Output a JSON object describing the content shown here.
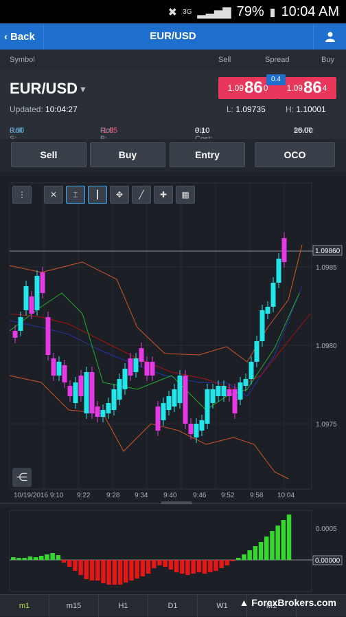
{
  "status": {
    "signal": "3G",
    "battery": "79%",
    "time": "10:04 AM"
  },
  "nav": {
    "back": "Back",
    "title": "EUR/USD"
  },
  "columns": {
    "symbol": "Symbol",
    "sell": "Sell",
    "spread": "Spread",
    "buy": "Buy"
  },
  "quote": {
    "symbol": "EUR/USD",
    "updated_label": "Updated:",
    "updated_time": "10:04:27",
    "sell_small": "1.09",
    "sell_big": "86",
    "sell_pip": "0",
    "buy_small": "1.09",
    "buy_big": "86",
    "buy_pip": "4",
    "spread": "0.4",
    "low_label": "L:",
    "low": "1.09735",
    "high_label": "H:",
    "high": "1.10001"
  },
  "stats": {
    "roll_s_label": "Roll S:",
    "roll_s": "0.90",
    "roll_b_label": "Roll B:",
    "roll_b": "-1.95",
    "pip_label": "Pip Cost:",
    "pip": "0.10",
    "mmr_label": "MMR:",
    "mmr": "26.00"
  },
  "buttons": {
    "sell": "Sell",
    "buy": "Buy",
    "entry": "Entry",
    "oco": "OCO"
  },
  "chart_data": {
    "type": "candlestick",
    "price_labels": [
      "1.0985",
      "1.0980",
      "1.0975"
    ],
    "current_price": "1.09860",
    "time_labels": [
      "10/19/2016 9:10",
      "9:22",
      "9:28",
      "9:34",
      "9:40",
      "9:46",
      "9:52",
      "9:58",
      "10:04"
    ],
    "indicator_labels": [
      "0.0005",
      "0.00000"
    ],
    "colors": {
      "up": "#23e6ea",
      "down": "#e639e6",
      "hist_up": "#35d630",
      "hist_down": "#e01818"
    }
  },
  "timeframes": [
    "m1",
    "m15",
    "H1",
    "D1",
    "W1",
    "M1"
  ],
  "watermark": "ForexBrokers.com"
}
